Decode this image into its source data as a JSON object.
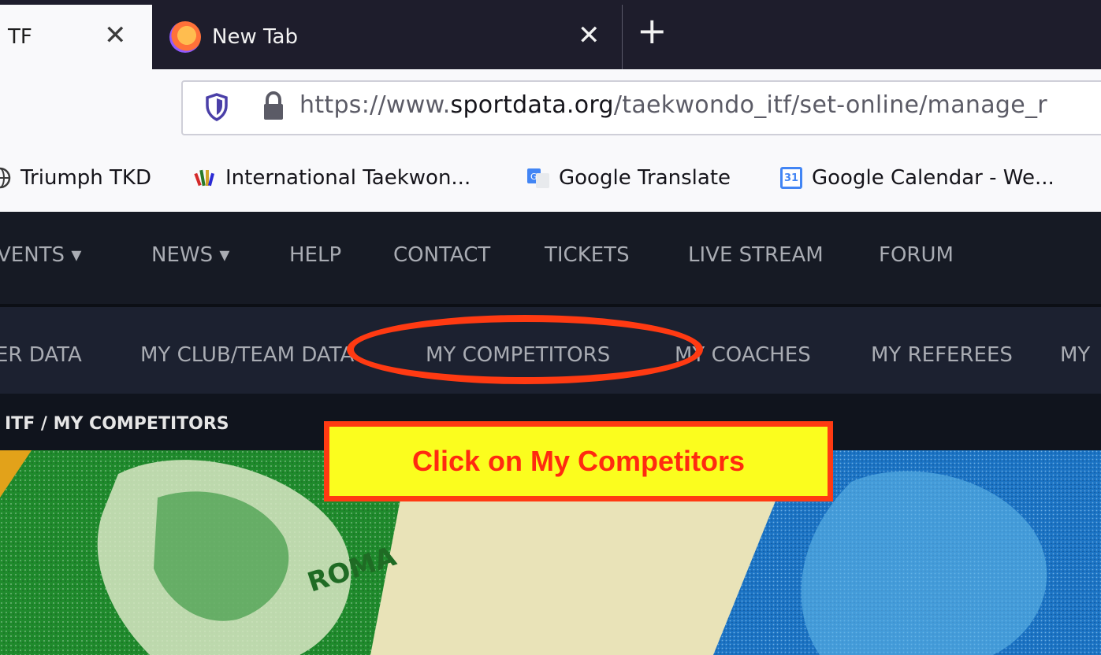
{
  "browser": {
    "tabs": [
      {
        "title": "TF",
        "active": true
      },
      {
        "title": "New Tab",
        "active": false
      }
    ],
    "new_tab_symbol": "+",
    "close_symbol": "✕",
    "url": {
      "prefix": "https://www.",
      "domain": "sportdata.org",
      "path": "/taekwondo_itf/set-online/manage_r"
    },
    "bookmarks": [
      {
        "label": "Triumph TKD",
        "icon": "globe-icon"
      },
      {
        "label": "International Taekwon...",
        "icon": "itf-logo-icon"
      },
      {
        "label": "Google Translate",
        "icon": "google-translate-icon"
      },
      {
        "label": "Google Calendar - We...",
        "icon": "google-calendar-icon",
        "icon_text": "31"
      }
    ]
  },
  "site": {
    "main_nav": [
      "VENTS ▾",
      "NEWS ▾",
      "HELP",
      "CONTACT",
      "TICKETS",
      "LIVE STREAM",
      "FORUM"
    ],
    "sub_nav": [
      "ER DATA",
      "MY CLUB/TEAM DATA",
      "MY COMPETITORS",
      "MY COACHES",
      "MY REFEREES",
      "MY"
    ],
    "breadcrumb": "ITF /  MY COMPETITORS"
  },
  "annotation": {
    "callout_text": "Click on My Competitors",
    "color": "#ff3a12",
    "callout_bg": "#fbfd1e"
  },
  "colors": {
    "tabstrip": "#1e1d2c",
    "site_nav": "#161a24",
    "sub_nav": "#1c2130"
  }
}
